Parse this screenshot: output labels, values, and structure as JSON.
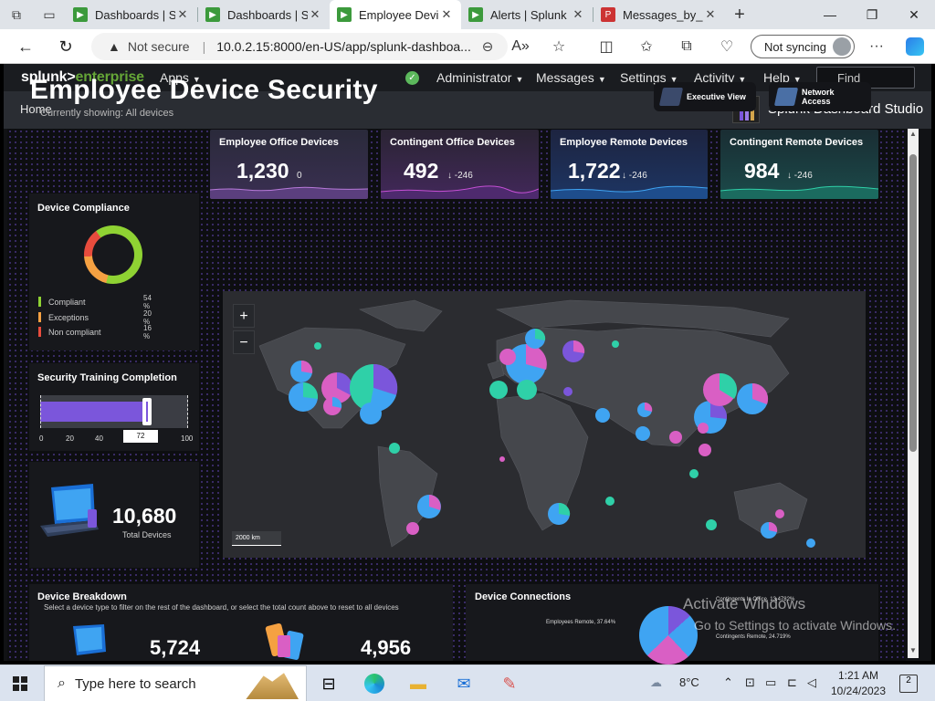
{
  "browser": {
    "tabs": [
      {
        "title": "Dashboards | S",
        "icon": "splunk-favicon"
      },
      {
        "title": "Dashboards | S",
        "icon": "splunk-favicon"
      },
      {
        "title": "Employee Devi",
        "icon": "splunk-favicon",
        "active": true
      },
      {
        "title": "Alerts | Splunk",
        "icon": "splunk-favicon"
      },
      {
        "title": "Messages_by_",
        "icon": "pdf-favicon"
      }
    ],
    "address": {
      "not_secure": "Not secure",
      "url": "10.0.2.15:8000/en-US/app/splunk-dashboa..."
    },
    "sync_label": "Not syncing"
  },
  "splunk": {
    "logo_a": "splunk>",
    "logo_b": "enterprise",
    "nav": {
      "apps": "Apps",
      "administrator": "Administrator",
      "messages": "Messages",
      "settings": "Settings",
      "activity": "Activity",
      "help": "Help",
      "find": "Find"
    },
    "home": "Home",
    "studio": "Splunk Dashboard Studio"
  },
  "dashboard": {
    "title": "Employee Device Security",
    "showing": "Currently showing: All devices",
    "view_buttons": {
      "executive": "Executive View",
      "network": "Network Access"
    },
    "compliance": {
      "title": "Device Compliance",
      "items": [
        {
          "label": "Compliant",
          "pct": "54 %",
          "color": "#8fd233"
        },
        {
          "label": "Exceptions",
          "pct": "20 %",
          "color": "#f5a142"
        },
        {
          "label": "Non compliant",
          "pct": "16 %",
          "color": "#e84c3d"
        }
      ]
    },
    "training": {
      "title": "Security Training Completion",
      "value": 72,
      "value_label": "72",
      "ticks": [
        "0",
        "20",
        "40",
        "",
        "100"
      ]
    },
    "total": {
      "value": "10,680",
      "label": "Total Devices"
    },
    "kpis": [
      {
        "title": "Employee Office Devices",
        "value": "1,230",
        "delta": "0"
      },
      {
        "title": "Contingent Office Devices",
        "value": "492",
        "delta": "↓ -246"
      },
      {
        "title": "Employee Remote Devices",
        "value": "1,722",
        "delta": "↓ -246"
      },
      {
        "title": "Contingent Remote Devices",
        "value": "984",
        "delta": "↓ -246"
      }
    ],
    "map": {
      "zoom_in": "+",
      "zoom_out": "−",
      "scale": "2000 km"
    },
    "breakdown": {
      "title": "Device Breakdown",
      "subtitle": "Select a device type to filter on the rest of the dashboard, or select the total count above to reset to all devices",
      "values": [
        "5,724",
        "4,956"
      ]
    },
    "connections": {
      "title": "Device Connections",
      "labels": {
        "top": "Contingents In Office, 13.4782%",
        "left": "Employees Remote, 37.64%",
        "right": "Contingents Remote, 24.719%"
      }
    }
  },
  "watermark": {
    "line1": "Activate Windows",
    "line2": "Go to Settings to activate Windows."
  },
  "taskbar": {
    "search_placeholder": "Type here to search",
    "weather": "8°C",
    "time": "1:21 AM",
    "date": "10/24/2023",
    "notifications": "2"
  }
}
